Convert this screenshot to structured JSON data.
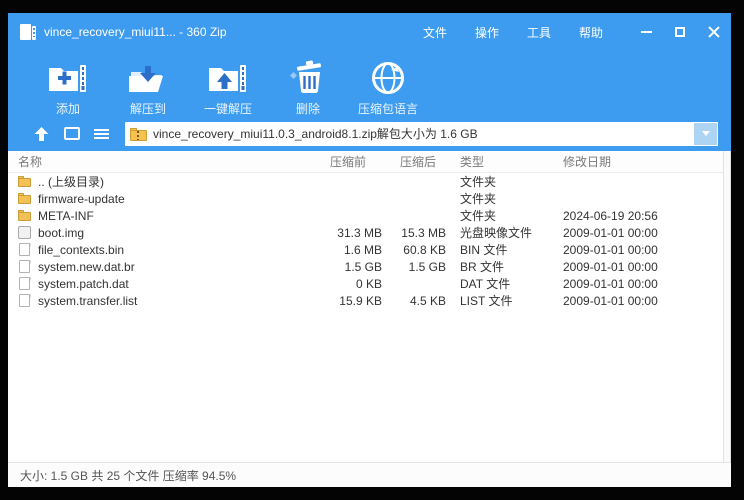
{
  "window": {
    "title": "vince_recovery_miui11... - 360 Zip",
    "menus": [
      "文件",
      "操作",
      "工具",
      "帮助"
    ]
  },
  "toolbar": {
    "buttons": [
      {
        "icon": "add-archive-icon",
        "label": "添加"
      },
      {
        "icon": "extract-to-icon",
        "label": "解压到"
      },
      {
        "icon": "one-click-extract-icon",
        "label": "一键解压"
      },
      {
        "icon": "delete-icon",
        "label": "删除"
      },
      {
        "icon": "archive-language-icon",
        "label": "压缩包语言"
      }
    ]
  },
  "addressbar": {
    "path": "vince_recovery_miui11.0.3_android8.1.zip解包大小为 1.6 GB"
  },
  "file_list": {
    "columns": [
      "名称",
      "压缩前",
      "压缩后",
      "类型",
      "修改日期"
    ],
    "rows": [
      {
        "name": ".. (上级目录)",
        "icon": "folder",
        "size_before": "",
        "size_after": "",
        "type": "文件夹",
        "date": ""
      },
      {
        "name": "firmware-update",
        "icon": "folder",
        "size_before": "",
        "size_after": "",
        "type": "文件夹",
        "date": ""
      },
      {
        "name": "META-INF",
        "icon": "folder",
        "size_before": "",
        "size_after": "",
        "type": "文件夹",
        "date": "2024-06-19 20:56"
      },
      {
        "name": "boot.img",
        "icon": "disc-image",
        "size_before": "31.3 MB",
        "size_after": "15.3 MB",
        "type": "光盘映像文件",
        "date": "2009-01-01 00:00"
      },
      {
        "name": "file_contexts.bin",
        "icon": "file",
        "size_before": "1.6 MB",
        "size_after": "60.8 KB",
        "type": "BIN 文件",
        "date": "2009-01-01 00:00"
      },
      {
        "name": "system.new.dat.br",
        "icon": "file",
        "size_before": "1.5 GB",
        "size_after": "1.5 GB",
        "type": "BR 文件",
        "date": "2009-01-01 00:00"
      },
      {
        "name": "system.patch.dat",
        "icon": "file",
        "size_before": "0 KB",
        "size_after": "",
        "type": "DAT 文件",
        "date": "2009-01-01 00:00"
      },
      {
        "name": "system.transfer.list",
        "icon": "file",
        "size_before": "15.9 KB",
        "size_after": "4.5 KB",
        "type": "LIST 文件",
        "date": "2009-01-01 00:00"
      }
    ]
  },
  "statusbar": {
    "text": "大小: 1.5 GB 共 25 个文件 压缩率 94.5%"
  },
  "colors": {
    "chrome_blue": "#3d9cef",
    "toolbar_icon_blue": "#2b6fc8",
    "folder_yellow": "#f2c155"
  }
}
